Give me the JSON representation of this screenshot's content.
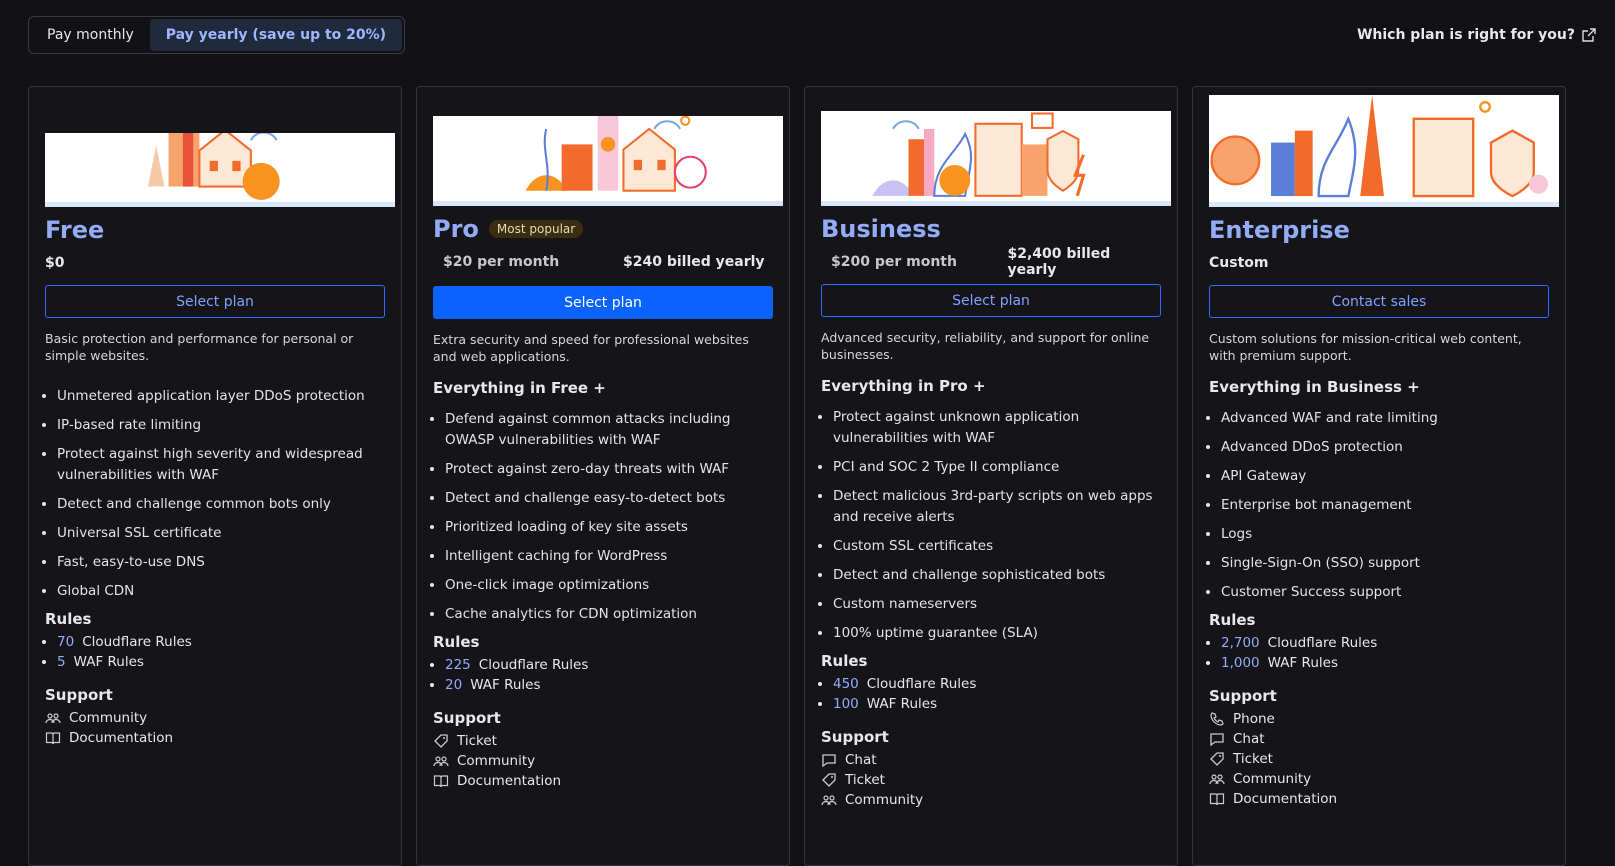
{
  "billing_toggle": {
    "monthly_label": "Pay monthly",
    "yearly_label": "Pay yearly (save up to 20%)",
    "active": "yearly"
  },
  "help_link": {
    "label": "Which plan is right for you?",
    "icon": "external-link-icon"
  },
  "colors": {
    "accent": "#93acf7",
    "primary_button": "#0a63ff",
    "background": "#121216"
  },
  "plans": [
    {
      "name": "Free",
      "badge": "",
      "price": "$0",
      "price_yearly": "",
      "button": "Select plan",
      "description": "Basic protection and performance for personal or simple websites.",
      "everything_in": "",
      "features": [
        "Unmetered application layer DDoS protection",
        "IP-based rate limiting",
        "Protect against high severity and widespread vulnerabilities with WAF",
        "Detect and challenge common bots only",
        "Universal SSL certificate",
        "Fast, easy-to-use DNS",
        "Global CDN"
      ],
      "rules_title": "Rules",
      "rules": [
        {
          "count": "70",
          "label": "Cloudflare Rules"
        },
        {
          "count": "5",
          "label": "WAF Rules"
        }
      ],
      "support_title": "Support",
      "support": [
        {
          "icon": "community-icon",
          "label": "Community"
        },
        {
          "icon": "documentation-icon",
          "label": "Documentation"
        }
      ]
    },
    {
      "name": "Pro",
      "badge": "Most popular",
      "price": "$20 per month",
      "price_yearly": "$240 billed yearly",
      "button": "Select plan",
      "description": "Extra security and speed for professional websites and web applications.",
      "everything_in": "Everything in Free +",
      "features": [
        "Defend against common attacks including OWASP vulnerabilities with WAF",
        "Protect against zero-day threats with WAF",
        "Detect and challenge easy-to-detect bots",
        "Prioritized loading of key site assets",
        "Intelligent caching for WordPress",
        "One-click image optimizations",
        "Cache analytics for CDN optimization"
      ],
      "rules_title": "Rules",
      "rules": [
        {
          "count": "225",
          "label": "Cloudflare Rules"
        },
        {
          "count": "20",
          "label": "WAF Rules"
        }
      ],
      "support_title": "Support",
      "support": [
        {
          "icon": "ticket-icon",
          "label": "Ticket"
        },
        {
          "icon": "community-icon",
          "label": "Community"
        },
        {
          "icon": "documentation-icon",
          "label": "Documentation"
        }
      ]
    },
    {
      "name": "Business",
      "badge": "",
      "price": "$200 per month",
      "price_yearly": "$2,400 billed yearly",
      "button": "Select plan",
      "description": "Advanced security, reliability, and support for online businesses.",
      "everything_in": "Everything in Pro +",
      "features": [
        "Protect against unknown application vulnerabilities with WAF",
        "PCI and SOC 2 Type II compliance",
        "Detect malicious 3rd-party scripts on web apps and receive alerts",
        "Custom SSL certificates",
        "Detect and challenge sophisticated bots",
        "Custom nameservers",
        "100% uptime guarantee (SLA)"
      ],
      "rules_title": "Rules",
      "rules": [
        {
          "count": "450",
          "label": "Cloudflare Rules"
        },
        {
          "count": "100",
          "label": "WAF Rules"
        }
      ],
      "support_title": "Support",
      "support": [
        {
          "icon": "chat-icon",
          "label": "Chat"
        },
        {
          "icon": "ticket-icon",
          "label": "Ticket"
        },
        {
          "icon": "community-icon",
          "label": "Community"
        }
      ]
    },
    {
      "name": "Enterprise",
      "badge": "",
      "price": "Custom",
      "price_yearly": "",
      "button": "Contact sales",
      "description": "Custom solutions for mission-critical web content, with premium support.",
      "everything_in": "Everything in Business +",
      "features": [
        "Advanced WAF and rate limiting",
        "Advanced DDoS protection",
        "API Gateway",
        "Enterprise bot management",
        "Logs",
        "Single-Sign-On (SSO) support",
        "Customer Success support"
      ],
      "rules_title": "Rules",
      "rules": [
        {
          "count": "2,700",
          "label": "Cloudflare Rules"
        },
        {
          "count": "1,000",
          "label": "WAF Rules"
        }
      ],
      "support_title": "Support",
      "support": [
        {
          "icon": "phone-icon",
          "label": "Phone"
        },
        {
          "icon": "chat-icon",
          "label": "Chat"
        },
        {
          "icon": "ticket-icon",
          "label": "Ticket"
        },
        {
          "icon": "community-icon",
          "label": "Community"
        },
        {
          "icon": "documentation-icon",
          "label": "Documentation"
        }
      ]
    }
  ]
}
